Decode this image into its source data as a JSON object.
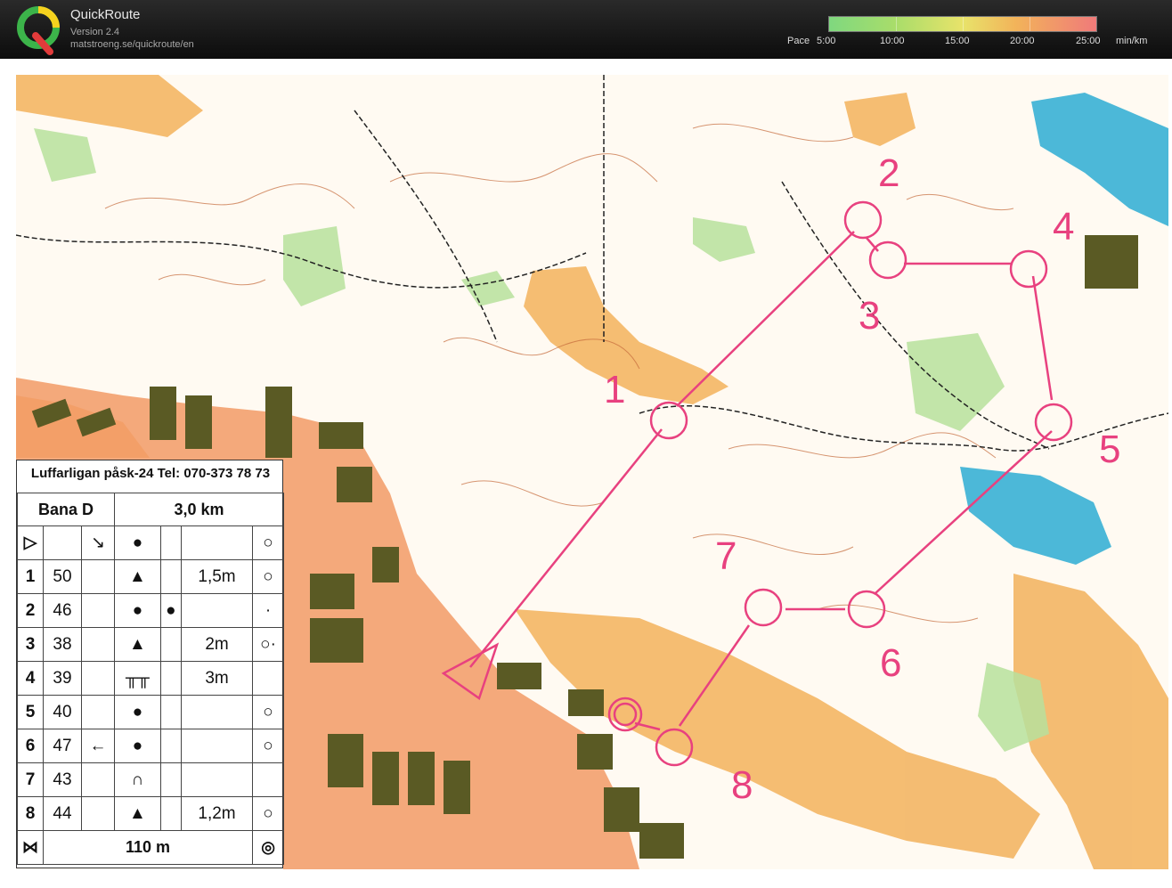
{
  "header": {
    "app_name": "QuickRoute",
    "version": "Version 2.4",
    "url": "matstroeng.se/quickroute/en",
    "pace_label": "Pace",
    "pace_ticks": [
      "5:00",
      "10:00",
      "15:00",
      "20:00",
      "25:00"
    ],
    "pace_unit": "min/km"
  },
  "course": {
    "control_labels": [
      "1",
      "2",
      "3",
      "4",
      "5",
      "6",
      "7",
      "8"
    ],
    "route_color": "#e8417f"
  },
  "legend": {
    "title": "Luffarligan påsk-24 Tel: 070-373 78 73",
    "course_name": "Bana D",
    "length": "3,0 km",
    "rows": [
      {
        "n": "1",
        "code": "50",
        "dim": "1,5m"
      },
      {
        "n": "2",
        "code": "46",
        "dim": ""
      },
      {
        "n": "3",
        "code": "38",
        "dim": "2m"
      },
      {
        "n": "4",
        "code": "39",
        "dim": "3m"
      },
      {
        "n": "5",
        "code": "40",
        "dim": ""
      },
      {
        "n": "6",
        "code": "47",
        "dim": ""
      },
      {
        "n": "7",
        "code": "43",
        "dim": ""
      },
      {
        "n": "8",
        "code": "44",
        "dim": "1,2m"
      }
    ],
    "finish_distance": "110 m"
  },
  "colors": {
    "open": "#f0a94a",
    "forest": "#ffffff",
    "green": "#a8d88a",
    "water": "#4cb8d8",
    "urban": "#f29a66",
    "building": "#4a4a1a",
    "contour": "#c46a3a"
  }
}
